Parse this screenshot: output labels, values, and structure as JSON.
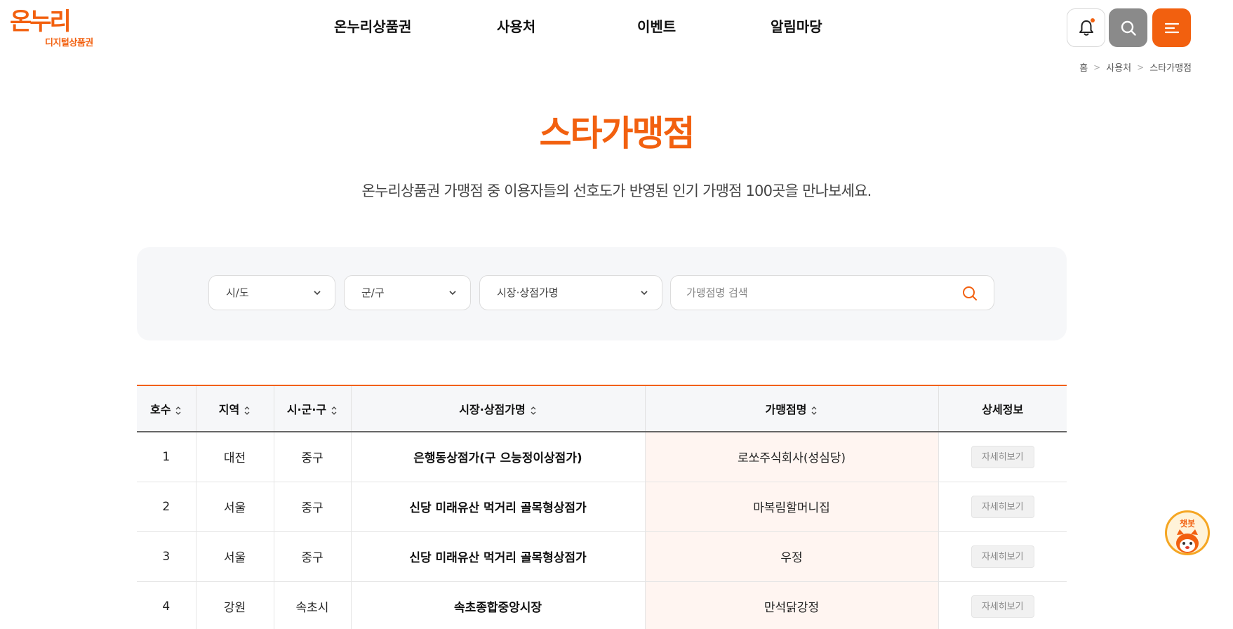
{
  "logo": {
    "main": "온누리",
    "sub": "디지털상품권"
  },
  "nav": {
    "items": [
      "온누리상품권",
      "사용처",
      "이벤트",
      "알림마당"
    ]
  },
  "icons": {
    "bell": "bell-icon",
    "search": "search-icon",
    "menu": "menu-icon",
    "chevron": "chevron-down-icon",
    "sort": "sort-icon",
    "chatbot": "chatbot-icon"
  },
  "colors": {
    "accent": "#f2600f",
    "search_button": "#8a8a8a",
    "highlight_column": "#fff5f1"
  },
  "breadcrumb": [
    "홈",
    "사용처",
    "스타가맹점"
  ],
  "page": {
    "title": "스타가맹점",
    "description": "온누리상품권 가맹점 중 이용자들의 선호도가 반영된 인기 가맹점 100곳을 만나보세요."
  },
  "filters": {
    "sido": "시/도",
    "gungu": "군/구",
    "market": "시장·상점가명",
    "search_placeholder": "가맹점명 검색"
  },
  "table": {
    "headers": [
      "호수",
      "지역",
      "시·군·구",
      "시장·상점가명",
      "가맹점명",
      "상세정보"
    ],
    "rows": [
      {
        "no": "1",
        "region": "대전",
        "district": "중구",
        "market": "은행동상점가(구 으능정이상점가)",
        "shop": "로쏘주식회사(성심당)",
        "detail": "자세히보기"
      },
      {
        "no": "2",
        "region": "서울",
        "district": "중구",
        "market": "신당 미래유산 먹거리 골목형상점가",
        "shop": "마복림할머니집",
        "detail": "자세히보기"
      },
      {
        "no": "3",
        "region": "서울",
        "district": "중구",
        "market": "신당 미래유산 먹거리 골목형상점가",
        "shop": "우정",
        "detail": "자세히보기"
      },
      {
        "no": "4",
        "region": "강원",
        "district": "속초시",
        "market": "속초종합중앙시장",
        "shop": "만석닭강정",
        "detail": "자세히보기"
      }
    ]
  },
  "chatbot": {
    "label": "챗봇"
  }
}
